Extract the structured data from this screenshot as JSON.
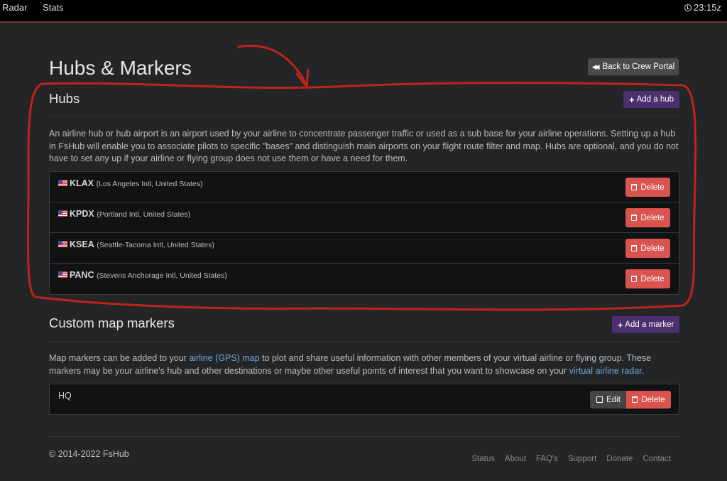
{
  "topbar": {
    "nav": [
      "Radar",
      "Stats"
    ],
    "clock": "23:15z"
  },
  "page": {
    "title": "Hubs & Markers",
    "back_label": "Back to Crew Portal"
  },
  "hubs": {
    "title": "Hubs",
    "add_label": "Add a hub",
    "description": "An airline hub or hub airport is an airport used by your airline to concentrate passenger traffic or used as a sub base for your airline operations. Setting up a hub in FsHub will enable you to associate pilots to specific \"bases\" and distinguish main airports on your flight route filter and map. Hubs are optional, and you do not have to set any up if your airline or flying group does not use them or have a need for them.",
    "delete_label": "Delete",
    "items": [
      {
        "code": "KLAX",
        "name": "(Los Angeles Intl, United States)"
      },
      {
        "code": "KPDX",
        "name": "(Portland Intl, United States)"
      },
      {
        "code": "KSEA",
        "name": "(Seattle-Tacoma Intl, United States)"
      },
      {
        "code": "PANC",
        "name": "(Stevens Anchorage Intl, United States)"
      }
    ]
  },
  "markers": {
    "title": "Custom map markers",
    "add_label": "Add a marker",
    "desc_part1": "Map markers can be added to your ",
    "desc_link1": "airline (GPS) map",
    "desc_part2": " to plot and share useful information with other members of your virtual airline or flying group. These markers may be your airline's hub and other destinations or maybe other useful points of interest that you want to showcase on your ",
    "desc_link2": "virtual airline radar",
    "desc_part3": ".",
    "edit_label": "Edit",
    "delete_label": "Delete",
    "items": [
      {
        "name": "HQ"
      }
    ]
  },
  "footer": {
    "copyright": "© 2014-2022 FsHub",
    "links": [
      "Status",
      "About",
      "FAQ's",
      "Support",
      "Donate",
      "Contact"
    ]
  },
  "colors": {
    "annotation": "#c0231a",
    "purple": "#4b2f6e",
    "delete": "#d9534f",
    "link": "#6fa8dc"
  }
}
